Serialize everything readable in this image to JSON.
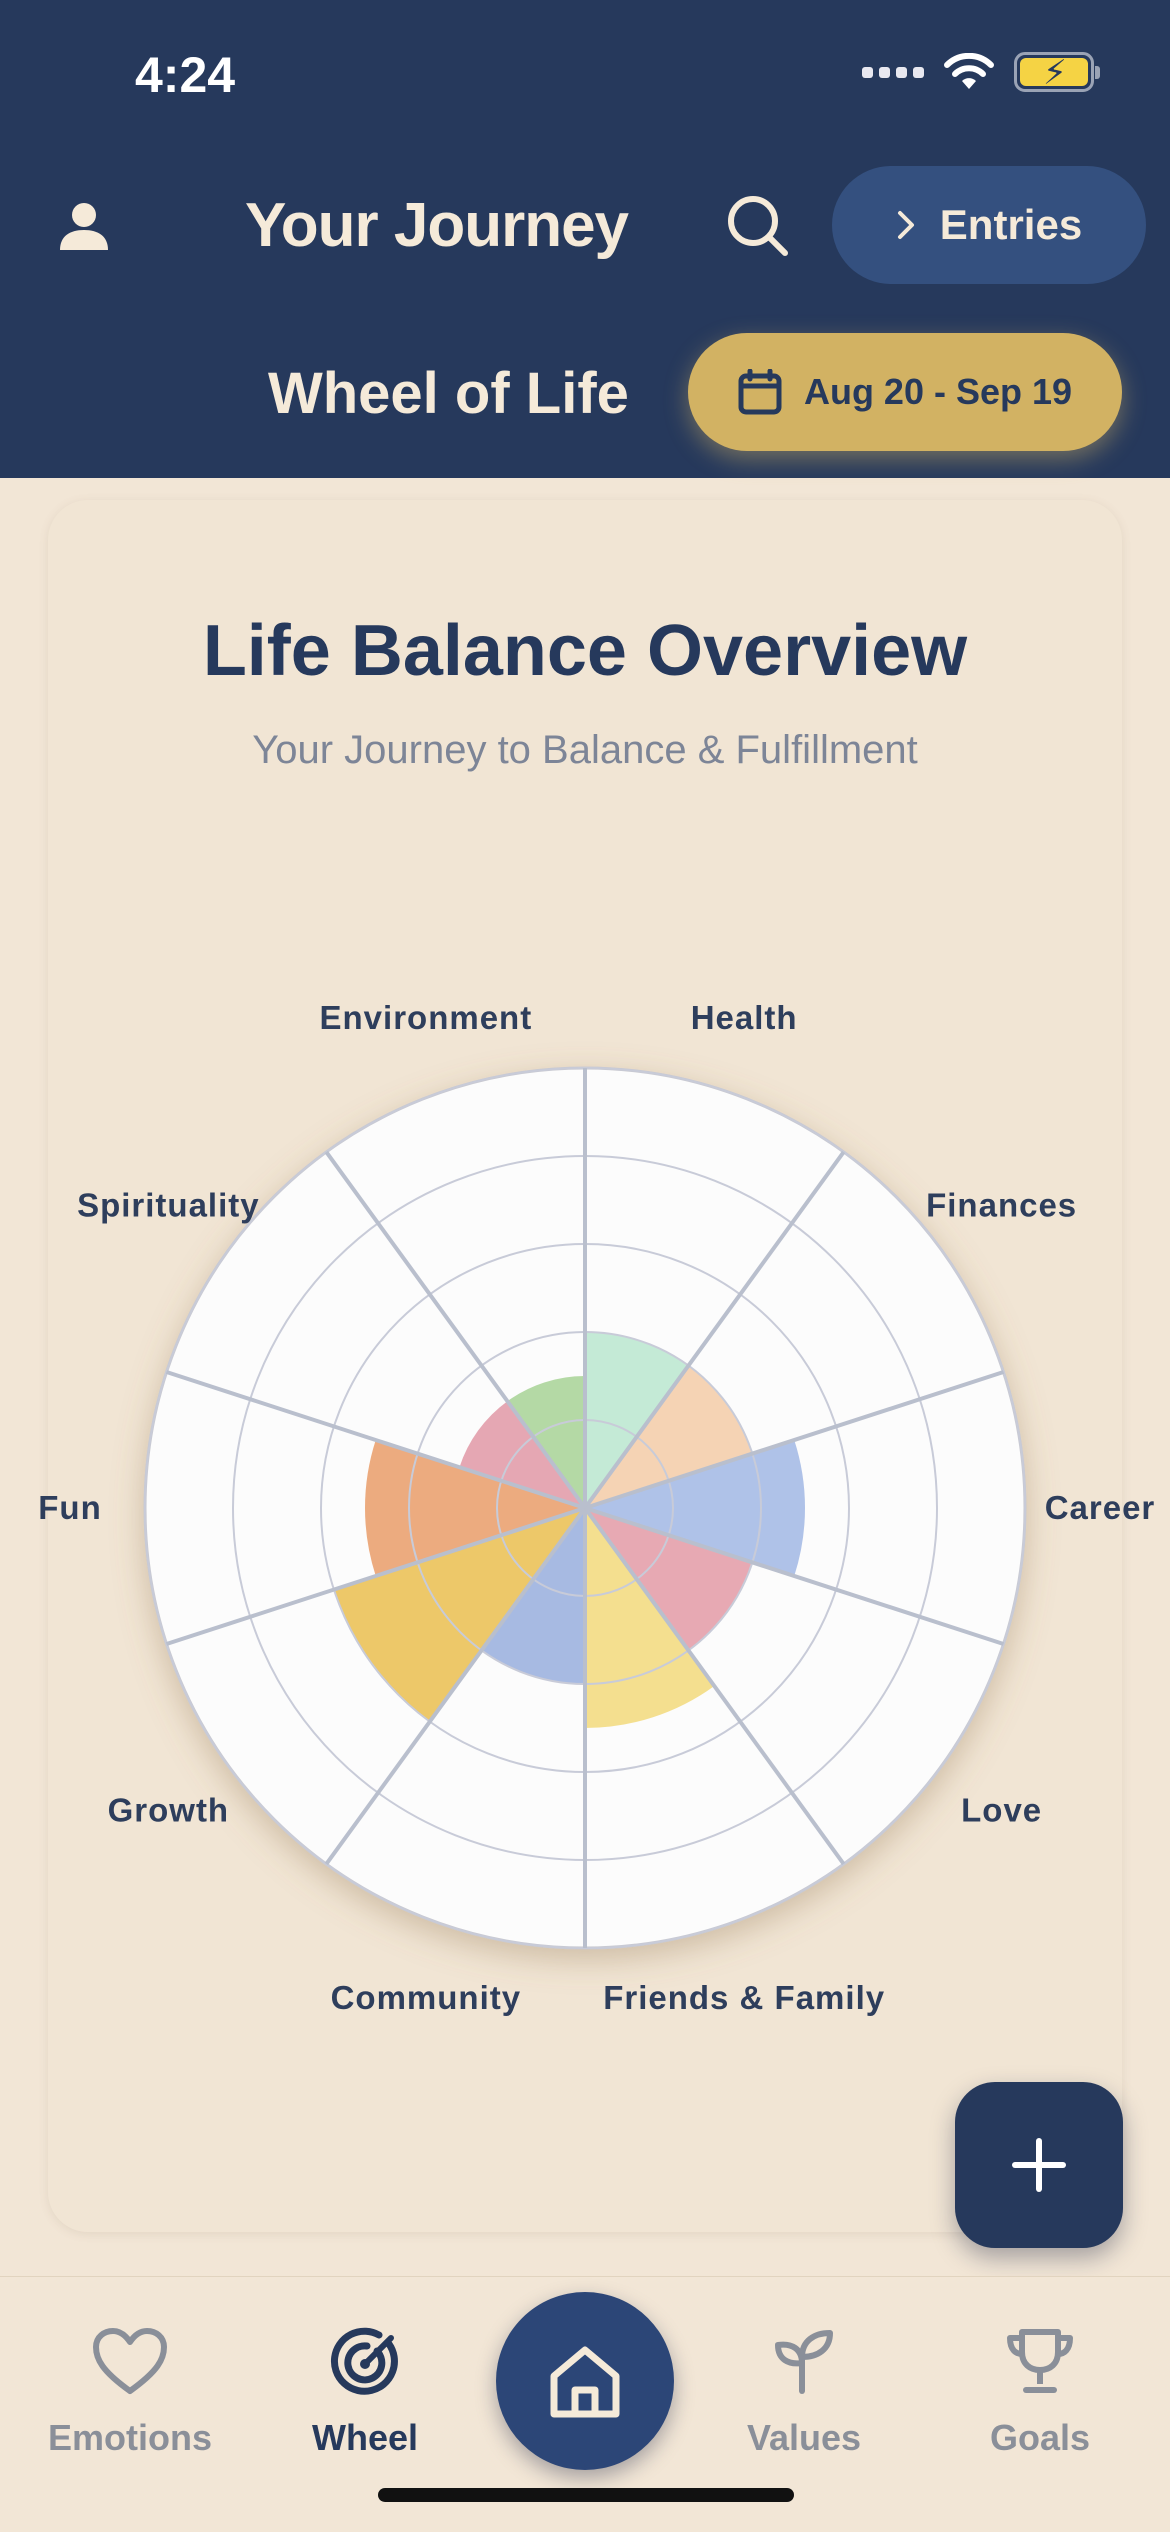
{
  "status_bar": {
    "time": "4:24"
  },
  "header": {
    "app_title": "Your Journey",
    "entries_label": "Entries",
    "page_title": "Wheel of Life",
    "date_range": "Aug 20 - Sep 19"
  },
  "card": {
    "title": "Life Balance Overview",
    "subtitle": "Your Journey to Balance & Fulfillment"
  },
  "chart_data": {
    "type": "polar-area",
    "scale_max": 10,
    "rings": 5,
    "grid": true,
    "categories": [
      "Health",
      "Finances",
      "Career",
      "Love",
      "Friends & Family",
      "Community",
      "Growth",
      "Fun",
      "Spirituality",
      "Environment"
    ],
    "values": [
      4,
      4,
      5,
      4,
      5,
      4,
      6,
      5,
      3,
      3
    ],
    "colors": [
      "#bfe8d3",
      "#f4cfae",
      "#a8bde6",
      "#e5a2ac",
      "#f3dc86",
      "#9fb4e0",
      "#ecc35c",
      "#eaa474",
      "#e3a0ad",
      "#aed69d"
    ]
  },
  "fab": {
    "icon": "plus-icon"
  },
  "bottom_nav": {
    "items": [
      {
        "label": "Emotions",
        "icon": "heart-icon"
      },
      {
        "label": "Wheel",
        "icon": "target-icon",
        "active": true
      },
      {
        "label": "Values",
        "icon": "sprout-icon"
      },
      {
        "label": "Goals",
        "icon": "trophy-icon"
      }
    ],
    "center_icon": "home-icon"
  },
  "colors": {
    "header_bg": "#26395c",
    "accent_gold": "#d2b263",
    "background": "#f2e6d6",
    "primary_navy": "#26395c"
  }
}
